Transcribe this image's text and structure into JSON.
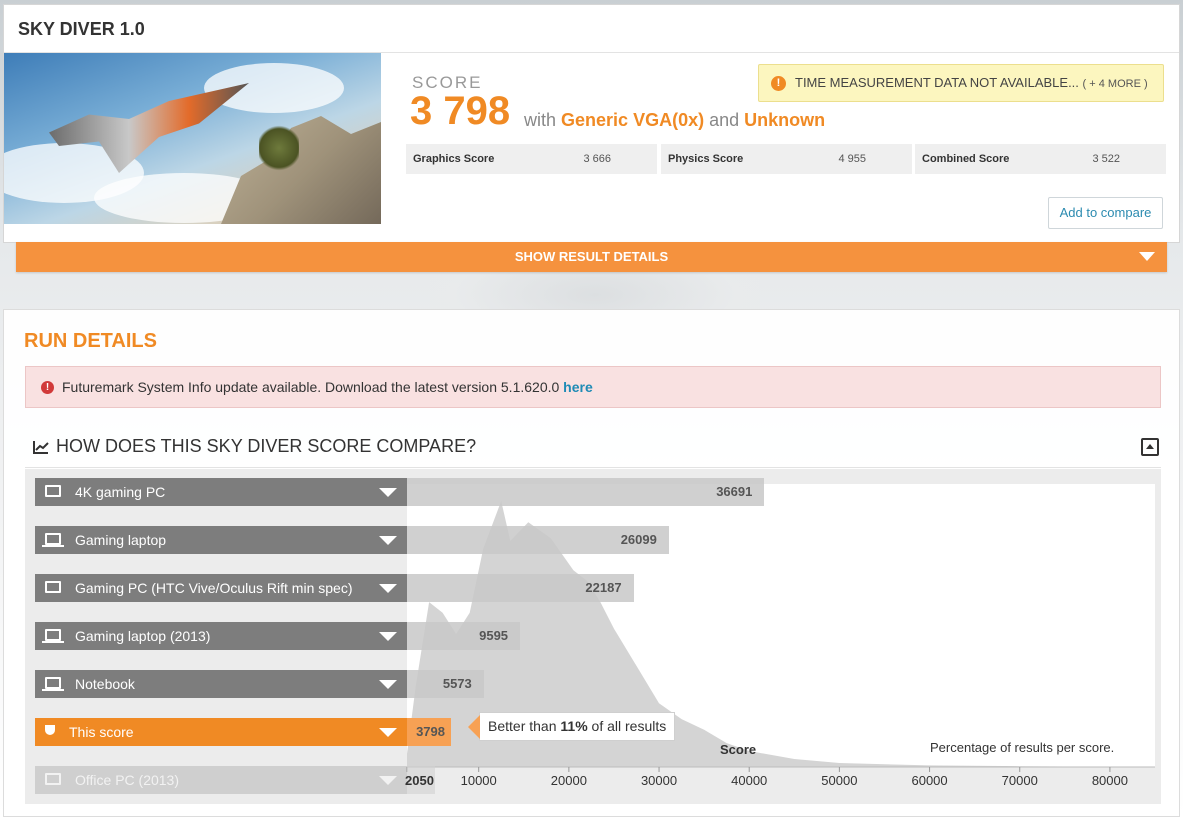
{
  "header": {
    "title": "SKY DIVER 1.0",
    "score_label": "SCORE",
    "score_value": "3 798",
    "with_text": "with",
    "gpu": "Generic VGA(0x)",
    "and_text": "and",
    "cpu": "Unknown",
    "warning": "TIME MEASUREMENT DATA NOT AVAILABLE...",
    "warning_more": "( + 4 MORE )",
    "sub_scores": [
      {
        "name": "Graphics Score",
        "value": "3 666"
      },
      {
        "name": "Physics Score",
        "value": "4 955"
      },
      {
        "name": "Combined Score",
        "value": "3 522"
      }
    ],
    "compare_button": "Add to compare",
    "show_details": "SHOW RESULT DETAILS"
  },
  "run": {
    "title": "RUN DETAILS",
    "alert_text": "Futuremark System Info update available. Download the latest version 5.1.620.0",
    "alert_link": "here",
    "compare_title": "HOW DOES THIS SKY DIVER SCORE COMPARE?",
    "tooltip_prefix": "Better than",
    "tooltip_pct": "11%",
    "tooltip_suffix": "of all results",
    "score_axis_label": "Score",
    "pct_label": "Percentage of results per score."
  },
  "chart_data": {
    "type": "area",
    "title": "",
    "xlabel": "Score",
    "ylabel": "Percentage of results per score.",
    "xlim": [
      2050,
      85000
    ],
    "x_ticks": [
      "2050",
      "10000",
      "20000",
      "30000",
      "40000",
      "50000",
      "60000",
      "70000",
      "80000"
    ],
    "x": [
      2050,
      3000,
      4500,
      6000,
      7500,
      9000,
      10500,
      12500,
      13500,
      15500,
      18000,
      20500,
      22000,
      23500,
      25000,
      27500,
      30000,
      32500,
      35000,
      37500,
      40000,
      45000,
      50000,
      60000,
      70000,
      80000,
      85000
    ],
    "y": [
      5,
      30,
      62,
      58,
      50,
      58,
      82,
      100,
      85,
      92,
      86,
      74,
      70,
      62,
      52,
      38,
      24,
      18,
      14,
      9,
      6,
      3,
      1.5,
      0.6,
      0.3,
      0.1,
      0
    ],
    "categories": [
      {
        "label": "4K gaming PC",
        "value": 36691,
        "display": "36691",
        "icon": "monitor-icon",
        "state": "normal"
      },
      {
        "label": "Gaming laptop",
        "value": 26099,
        "display": "26099",
        "icon": "laptop-icon",
        "state": "normal"
      },
      {
        "label": "Gaming PC (HTC Vive/Oculus Rift min spec)",
        "value": 22187,
        "display": "22187",
        "icon": "monitor-icon",
        "state": "normal"
      },
      {
        "label": "Gaming laptop (2013)",
        "value": 9595,
        "display": "9595",
        "icon": "laptop-icon",
        "state": "normal"
      },
      {
        "label": "Notebook",
        "value": 5573,
        "display": "5573",
        "icon": "laptop-icon",
        "state": "normal"
      },
      {
        "label": "This score",
        "value": 3798,
        "display": "3798",
        "icon": "trophy-icon",
        "state": "active"
      },
      {
        "label": "Office PC (2013)",
        "value": 2050,
        "display": "",
        "icon": "monitor-icon",
        "state": "faded"
      }
    ],
    "colors": {
      "accent": "#f08a24",
      "bar": "#7d7d7d",
      "area": "#d4d4d4"
    }
  }
}
